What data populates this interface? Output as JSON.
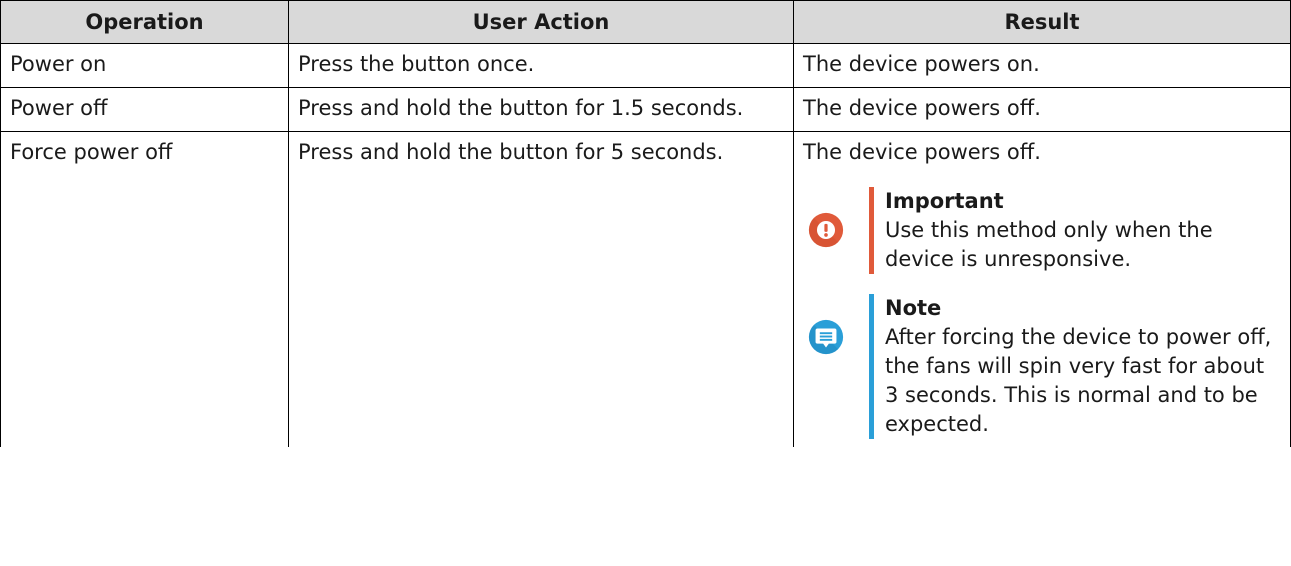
{
  "table": {
    "headers": [
      "Operation",
      "User Action",
      "Result"
    ],
    "rows": [
      {
        "operation": "Power on",
        "action": "Press the button once.",
        "result": "The device powers on."
      },
      {
        "operation": "Power off",
        "action": "Press and hold the button for 1.5 seconds.",
        "result": "The device powers off."
      },
      {
        "operation": "Force power off",
        "action": "Press and hold the button for 5 seconds.",
        "result": "The device powers off."
      }
    ]
  },
  "callouts": {
    "important": {
      "title": "Important",
      "text": "Use this method only when the device is unresponsive.",
      "icon": "exclamation-circle-icon",
      "color": "#e05a3a"
    },
    "note": {
      "title": "Note",
      "text": "After forcing the device to power off, the fans will spin very fast for about 3 seconds. This is normal and to be expected.",
      "icon": "note-bubble-icon",
      "color": "#2a9fd8"
    }
  }
}
